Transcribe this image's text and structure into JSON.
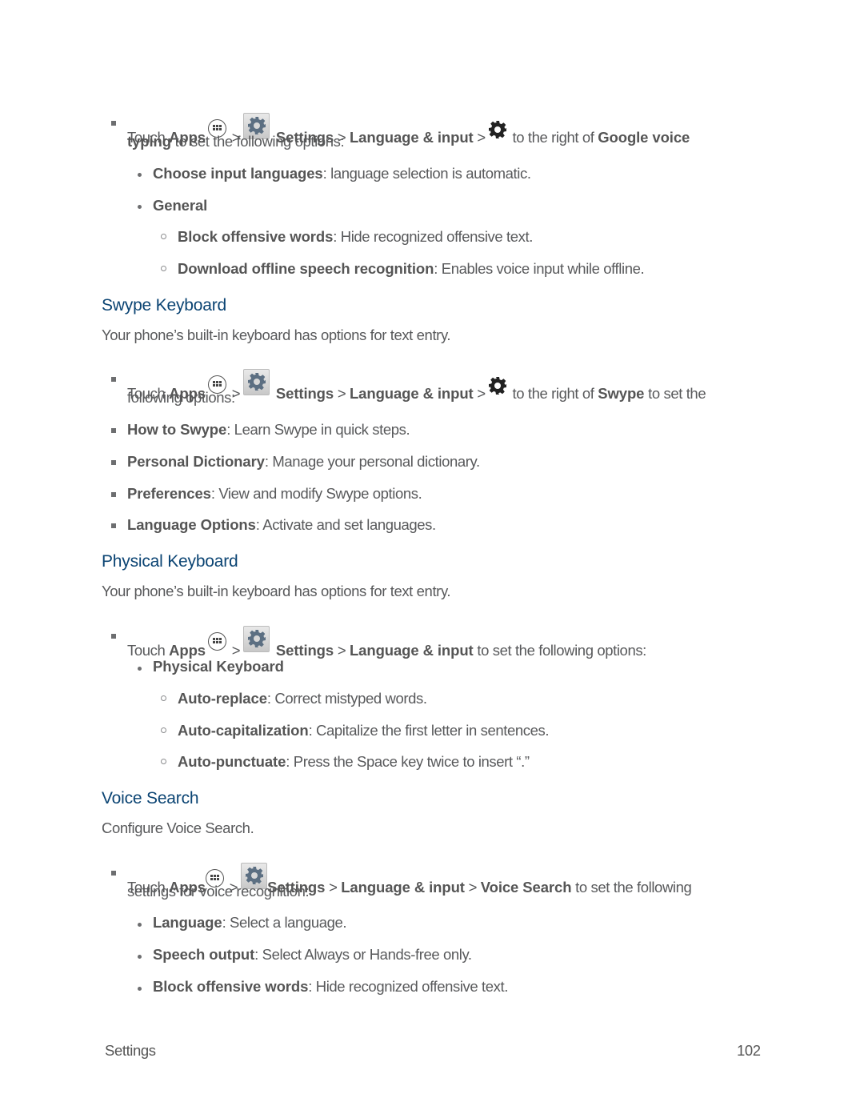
{
  "sections": {
    "google_voice": {
      "step": {
        "touch": "Touch",
        "apps": "Apps",
        "sep1": ">",
        "settings": "Settings",
        "sep2": ">",
        "lang_input": "Language & input",
        "sep3": ">",
        "right_of": "to the right of",
        "target": "Google voice",
        "target2": "typing",
        "tail": "to set the following options:"
      },
      "items": [
        {
          "term": "Choose input languages",
          "desc": ": language selection is automatic."
        },
        {
          "term": "General",
          "desc": ""
        }
      ],
      "subitems": [
        {
          "term": "Block offensive words",
          "desc": ": Hide recognized offensive text."
        },
        {
          "term": "Download offline speech recognition",
          "desc": ": Enables voice input while offline."
        }
      ]
    },
    "swype": {
      "heading": "Swype Keyboard",
      "intro": "Your phone’s built-in keyboard has options for text entry.",
      "step": {
        "touch": "Touch",
        "apps": "Apps",
        "sep1": ">",
        "settings": "Settings",
        "sep2": ">",
        "lang_input": "Language & input",
        "sep3": ">",
        "right_of": "to the right of",
        "target": "Swype",
        "tail": "to set the",
        "tail2": "following options:"
      },
      "items": [
        {
          "term": "How to Swype",
          "desc": ": Learn Swype in quick steps."
        },
        {
          "term": "Personal Dictionary",
          "desc": ": Manage your personal dictionary."
        },
        {
          "term": "Preferences",
          "desc": ": View and modify Swype options."
        },
        {
          "term": "Language Options",
          "desc": ": Activate and set languages."
        }
      ]
    },
    "physical": {
      "heading": "Physical Keyboard",
      "intro": "Your phone’s built-in keyboard has options for text entry.",
      "step": {
        "touch": "Touch",
        "apps": "Apps",
        "sep1": ">",
        "settings": "Settings",
        "sep2": ">",
        "lang_input": "Language & input",
        "tail": "to set the following options:"
      },
      "items": [
        {
          "term": "Physical Keyboard",
          "desc": ""
        }
      ],
      "subitems": [
        {
          "term": "Auto-replace",
          "desc": ": Correct mistyped words."
        },
        {
          "term": "Auto-capitalization",
          "desc": ": Capitalize the first letter in sentences."
        },
        {
          "term": "Auto-punctuate",
          "desc": ": Press the Space key twice to insert “.”"
        }
      ]
    },
    "voice": {
      "heading": "Voice Search",
      "intro": "Configure Voice Search.",
      "step": {
        "touch": "Touch",
        "apps": "Apps",
        "sep1": ">",
        "settings": "Settings",
        "sep2": ">",
        "lang_input": "Language & input",
        "sep3": ">",
        "target": "Voice Search",
        "tail": "to set the following",
        "tail2": "settings for voice recognition:"
      },
      "items": [
        {
          "term": "Language",
          "desc": ": Select a language."
        },
        {
          "term": "Speech output",
          "desc": ": Select Always or Hands-free only."
        },
        {
          "term": "Block offensive words",
          "desc": ": Hide recognized offensive text."
        }
      ]
    }
  },
  "footer": {
    "section": "Settings",
    "page_number": "102"
  },
  "icons": {
    "apps": "apps-icon",
    "settings": "settings-app-icon",
    "gear": "gear-icon"
  }
}
